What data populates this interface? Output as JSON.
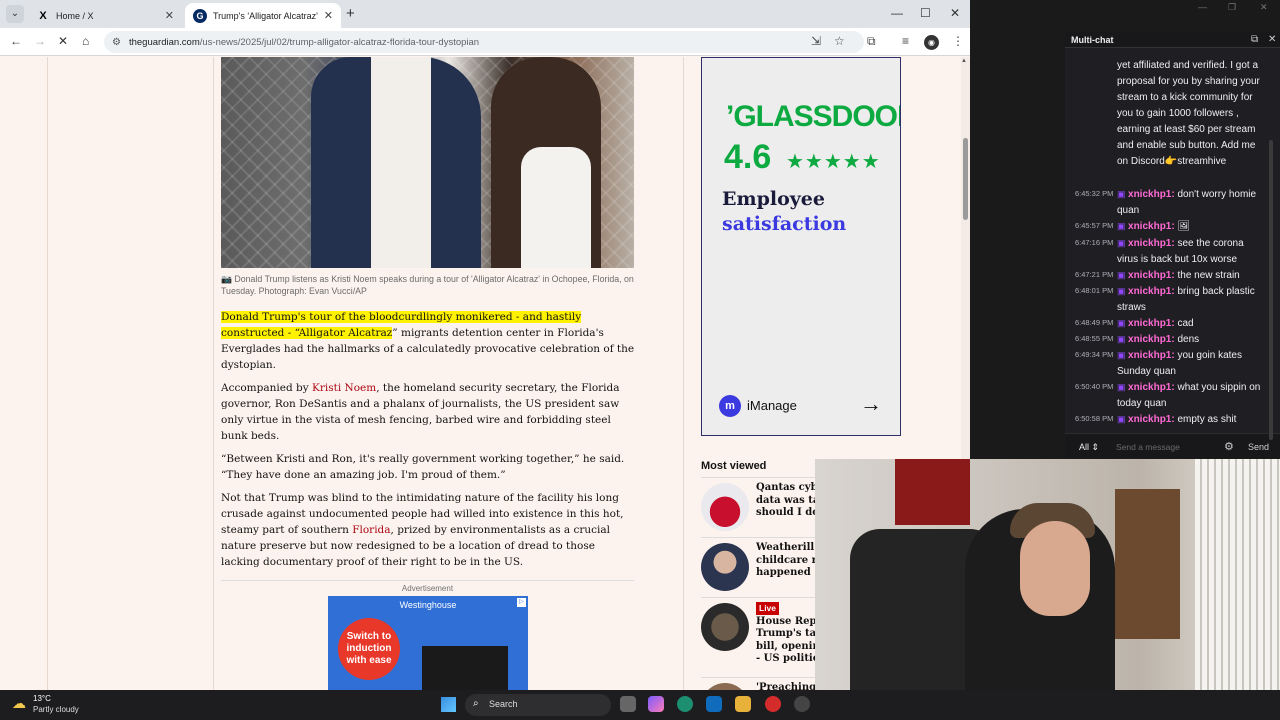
{
  "browser": {
    "tabs": [
      {
        "label": "Home / X",
        "favicon": "x-logo-icon"
      },
      {
        "label": "Trump's 'Alligator Alcatraz' tour",
        "favicon": "guardian-icon",
        "active": true
      }
    ],
    "url_domain": "theguardian.com",
    "url_path": "/us-news/2025/jul/02/trump-alligator-alcatraz-florida-tour-dystopian"
  },
  "article": {
    "caption": "Donald Trump listens as Kristi Noem speaks during a tour of 'Alligator Alcatraz' in Ochopee, Florida, on Tuesday. Photograph: Evan Vucci/AP",
    "p1_highlight": "Donald Trump's tour of the bloodcurdlingly monikered - and hastily constructed - “Alligator Alcatraz",
    "p1_rest": "” migrants detention center in Florida's Everglades had the hallmarks of a calculatedly provocative celebration of the dystopian.",
    "p2_pre": "Accompanied by ",
    "p2_link": "Kristi Noem",
    "p2_post": ", the homeland security secretary, the Florida governor, Ron DeSantis and a phalanx of journalists, the US president saw only virtue in the vista of mesh fencing, barbed wire and forbidding steel bunk beds.",
    "p3": "“Between Kristi and Ron, it's really government working together,” he said. “They have done an amazing job. I'm proud of them.”",
    "p4_pre": "Not that Trump was blind to the intimidating nature of the facility his long crusade against undocumented people had willed into existence in this hot, steamy part of southern ",
    "p4_link": "Florida",
    "p4_post": ", prized by environmentalists as a crucial nature preserve but now redesigned to be a location of dread to those lacking documentary proof of their right to be in the US.",
    "ad_label": "Advertisement"
  },
  "ads": {
    "glassdoor": {
      "brand": "’GLASSDOOR’",
      "rating": "4.6",
      "stars": "★★★★★",
      "line1": "Employee",
      "line2": "satisfaction",
      "sponsor": "iManage",
      "sponsor_icon_letter": "m"
    },
    "westinghouse": {
      "brand": "Westinghouse",
      "cta": "Switch to induction with ease"
    }
  },
  "most_viewed": {
    "title": "Most viewed",
    "items": [
      {
        "lines": [
          "Qantas cybe",
          "data was tal",
          "should I do"
        ]
      },
      {
        "lines": [
          "Weatherill t",
          "childcare re",
          "happened"
        ]
      },
      {
        "live": "Live",
        "lines": [
          "House Repu",
          "Trump's tax",
          "bill, openin",
          "- US politics"
        ]
      },
      {
        "lines": [
          "'Preaching"
        ]
      }
    ]
  },
  "chat": {
    "title": "Multi-chat",
    "messages": [
      {
        "time": "",
        "user": "",
        "text": "yet affiliated and verified. I got a proposal for you by sharing your stream to a kick community for you to gain 1000 followers , earning at least $60 per stream and enable sub button. Add me on Discord👉streamhive"
      },
      {
        "time": "6:45:32 PM",
        "user": "xnickhp1:",
        "text": " don't worry homie quan"
      },
      {
        "time": "6:45:57 PM",
        "user": "xnickhp1:",
        "text": " 🖼"
      },
      {
        "time": "6:47:16 PM",
        "user": "xnickhp1:",
        "text": " see the corona virus is back but 10x worse"
      },
      {
        "time": "6:47:21 PM",
        "user": "xnickhp1:",
        "text": " the new strain"
      },
      {
        "time": "6:48:01 PM",
        "user": "xnickhp1:",
        "text": " bring back plastic straws"
      },
      {
        "time": "6:48:49 PM",
        "user": "xnickhp1:",
        "text": " cad"
      },
      {
        "time": "6:48:55 PM",
        "user": "xnickhp1:",
        "text": " dens"
      },
      {
        "time": "6:49:34 PM",
        "user": "xnickhp1:",
        "text": " you goin kates Sunday quan"
      },
      {
        "time": "6:50:40 PM",
        "user": "xnickhp1:",
        "text": " what you sippin on today quan"
      },
      {
        "time": "6:50:58 PM",
        "user": "xnickhp1:",
        "text": " empty as shit"
      }
    ],
    "filter": "All",
    "input_placeholder": "Send a message",
    "send_label": "Send"
  },
  "taskbar": {
    "temp": "13°C",
    "weather": "Partly cloudy",
    "search_label": "Search"
  },
  "colors": {
    "page_bg": "#fdf3ee",
    "highlight": "#fff200",
    "guardian_link": "#ab0613",
    "glassdoor_green": "#0caa41",
    "chat_user": "#ff6ad5"
  }
}
